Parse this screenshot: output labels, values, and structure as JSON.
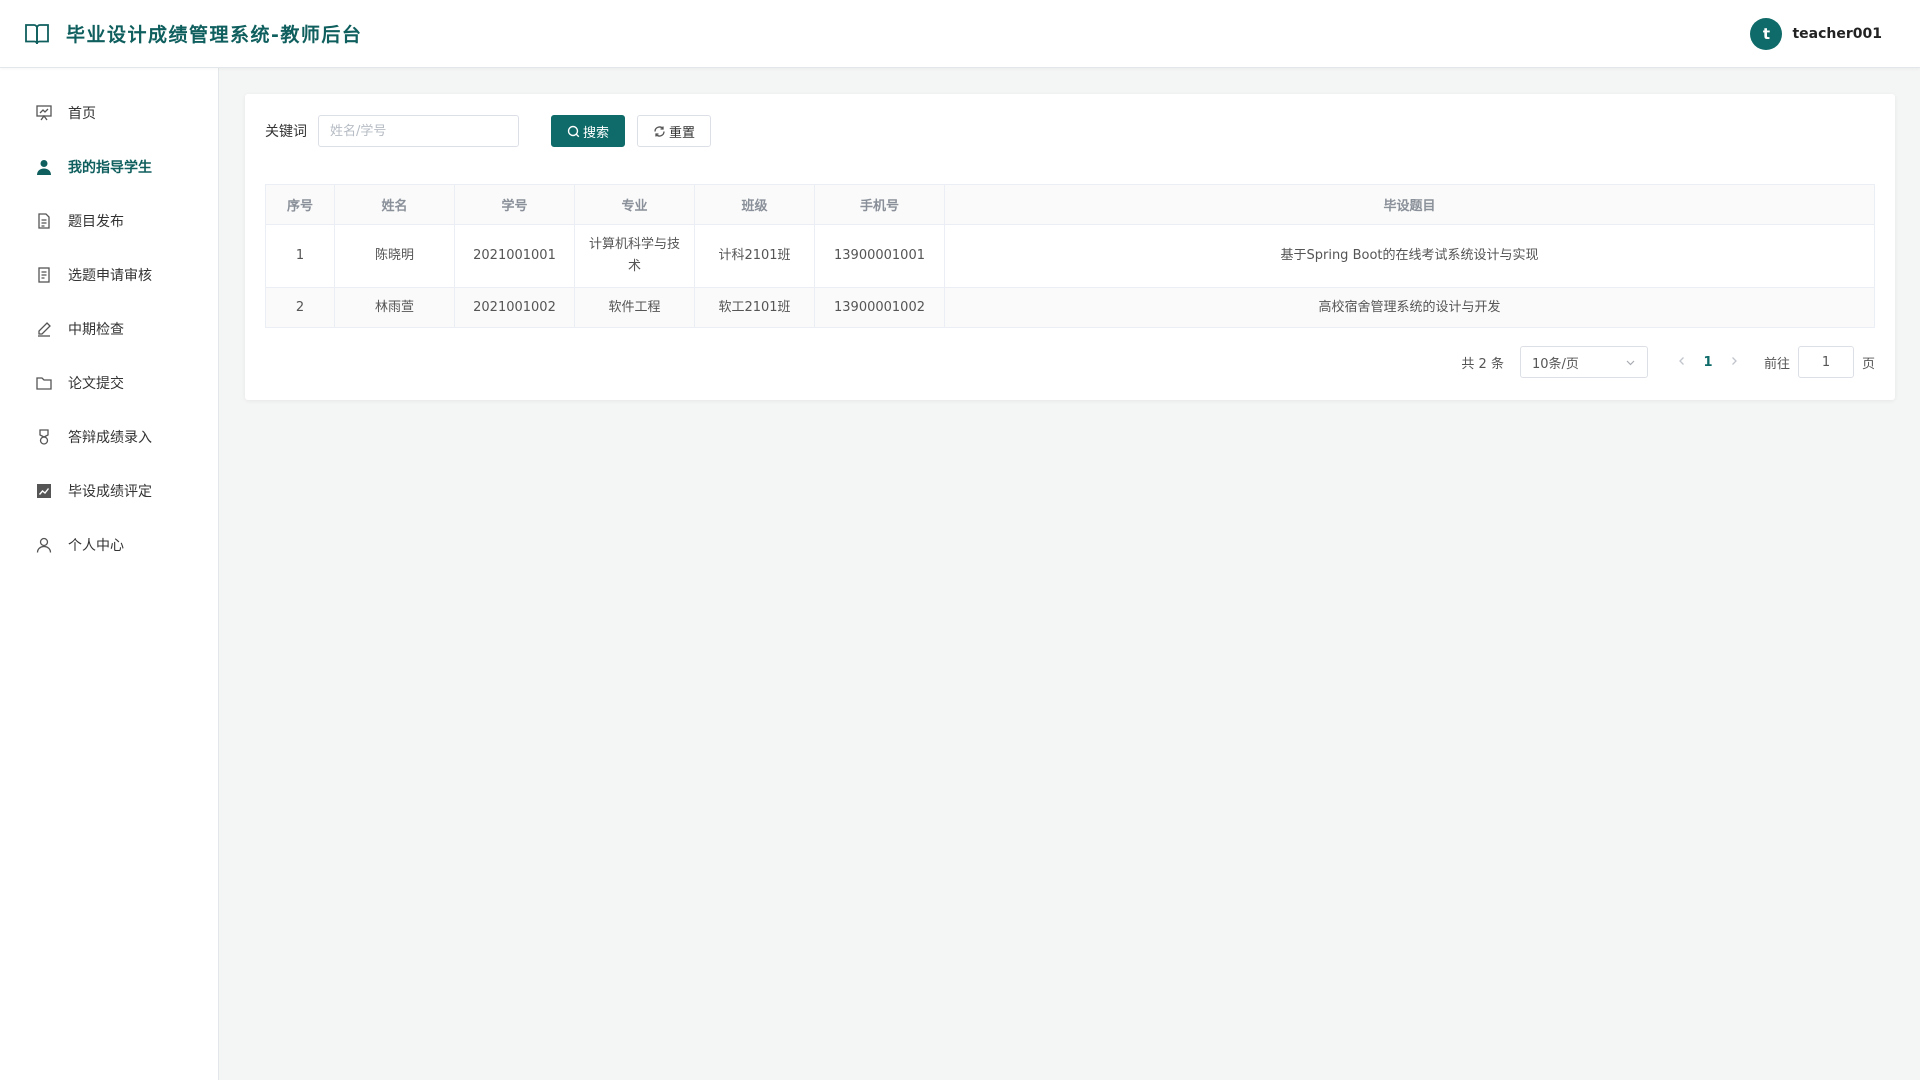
{
  "header": {
    "title": "毕业设计成绩管理系统-教师后台",
    "avatar_letter": "t",
    "username": "teacher001"
  },
  "sidebar": {
    "items": [
      {
        "label": "首页",
        "icon": "dashboard-icon"
      },
      {
        "label": "我的指导学生",
        "icon": "user-icon",
        "active": true
      },
      {
        "label": "题目发布",
        "icon": "document-icon"
      },
      {
        "label": "选题申请审核",
        "icon": "document-check-icon"
      },
      {
        "label": "中期检查",
        "icon": "edit-pen-icon"
      },
      {
        "label": "论文提交",
        "icon": "folder-icon"
      },
      {
        "label": "答辩成绩录入",
        "icon": "medal-icon"
      },
      {
        "label": "毕设成绩评定",
        "icon": "chart-icon"
      },
      {
        "label": "个人中心",
        "icon": "user-outline-icon"
      }
    ]
  },
  "filter": {
    "label": "关键词",
    "placeholder": "姓名/学号",
    "search_label": "搜索",
    "reset_label": "重置"
  },
  "table": {
    "headers": [
      "序号",
      "姓名",
      "学号",
      "专业",
      "班级",
      "手机号",
      "毕设题目"
    ],
    "rows": [
      [
        "1",
        "陈晓明",
        "2021001001",
        "计算机科学与技术",
        "计科2101班",
        "13900001001",
        "基于Spring Boot的在线考试系统设计与实现"
      ],
      [
        "2",
        "林雨萱",
        "2021001002",
        "软件工程",
        "软工2101班",
        "13900001002",
        "高校宿舍管理系统的设计与开发"
      ]
    ]
  },
  "pagination": {
    "total_text": "共 2 条",
    "page_size": "10条/页",
    "current_page": "1",
    "goto_label": "前往",
    "goto_value": "1",
    "page_suffix": "页"
  },
  "colors": {
    "primary": "#0f6b69",
    "title": "#0f5f5e"
  }
}
